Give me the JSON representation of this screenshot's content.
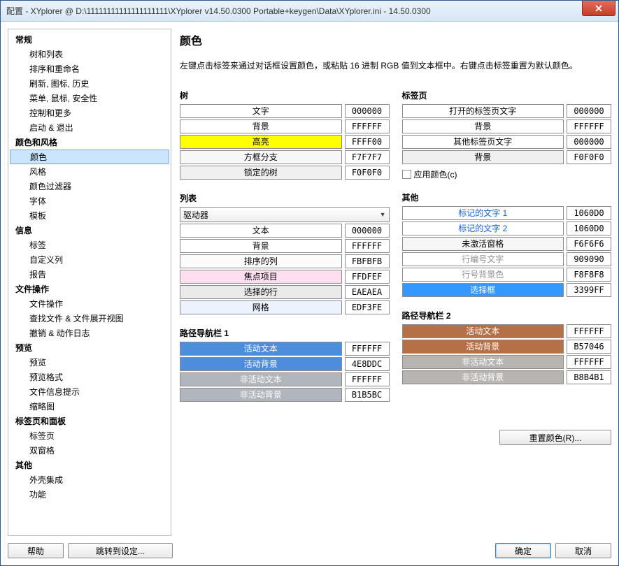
{
  "window": {
    "title": "配置 - XYplorer @ D:\\11111111111111111111\\XYplorer v14.50.0300 Portable+keygen\\Data\\XYplorer.ini - 14.50.0300"
  },
  "sidebar": {
    "groups": [
      {
        "label": "常规",
        "children": [
          "树和列表",
          "排序和重命名",
          "刷新, 图标, 历史",
          "菜单, 鼠标, 安全性",
          "控制和更多",
          "启动 & 退出"
        ]
      },
      {
        "label": "颜色和风格",
        "children": [
          "颜色",
          "风格",
          "颜色过滤器",
          "字体",
          "模板"
        ],
        "selectedIndex": 0
      },
      {
        "label": "信息",
        "children": [
          "标签",
          "自定义列",
          "报告"
        ]
      },
      {
        "label": "文件操作",
        "children": [
          "文件操作",
          "查找文件 & 文件展开视图",
          "撤销 & 动作日志"
        ]
      },
      {
        "label": "预览",
        "children": [
          "预览",
          "预览格式",
          "文件信息提示",
          "缩略图"
        ]
      },
      {
        "label": "标签页和面板",
        "children": [
          "标签页",
          "双窗格"
        ]
      },
      {
        "label": "其他",
        "children": [
          "外壳集成",
          "功能"
        ]
      }
    ]
  },
  "content": {
    "title": "颜色",
    "description": "左键点击标签来通过对话框设置颜色，或粘贴 16 进制 RGB 值到文本框中。右键点击标签重置为默认颜色。",
    "sections": {
      "tree": {
        "label": "树",
        "rows": [
          {
            "name": "文字",
            "hex": "000000",
            "bg": "#FFFFFF",
            "fg": "#000000"
          },
          {
            "name": "背景",
            "hex": "FFFFFF",
            "bg": "#FFFFFF",
            "fg": "#000000"
          },
          {
            "name": "高亮",
            "hex": "FFFF00",
            "bg": "#FFFF00",
            "fg": "#000000"
          },
          {
            "name": "方框分支",
            "hex": "F7F7F7",
            "bg": "#F7F7F7",
            "fg": "#000000"
          },
          {
            "name": "锁定的树",
            "hex": "F0F0F0",
            "bg": "#F0F0F0",
            "fg": "#000000"
          }
        ]
      },
      "list": {
        "label": "列表",
        "dropdown": "驱动器",
        "rows": [
          {
            "name": "文本",
            "hex": "000000",
            "bg": "#FFFFFF",
            "fg": "#000000"
          },
          {
            "name": "背景",
            "hex": "FFFFFF",
            "bg": "#FFFFFF",
            "fg": "#000000"
          },
          {
            "name": "排序的列",
            "hex": "FBFBFB",
            "bg": "#FBFBFB",
            "fg": "#000000"
          },
          {
            "name": "焦点项目",
            "hex": "FFDFEF",
            "bg": "#FFDFEF",
            "fg": "#000000"
          },
          {
            "name": "选择的行",
            "hex": "EAEAEA",
            "bg": "#EAEAEA",
            "fg": "#000000"
          },
          {
            "name": "网格",
            "hex": "EDF3FE",
            "bg": "#EDF3FE",
            "fg": "#000000"
          }
        ]
      },
      "crumb1": {
        "label": "路径导航栏 1",
        "rows": [
          {
            "name": "活动文本",
            "hex": "FFFFFF",
            "bg": "#4E8DDC",
            "fg": "#FFFFFF"
          },
          {
            "name": "活动背景",
            "hex": "4E8DDC",
            "bg": "#4E8DDC",
            "fg": "#FFFFFF"
          },
          {
            "name": "非活动文本",
            "hex": "FFFFFF",
            "bg": "#B1B5BC",
            "fg": "#FFFFFF"
          },
          {
            "name": "非活动背景",
            "hex": "B1B5BC",
            "bg": "#B1B5BC",
            "fg": "#FFFFFF"
          }
        ]
      },
      "tabs": {
        "label": "标签页",
        "rows": [
          {
            "name": "打开的标签页文字",
            "hex": "000000",
            "bg": "#FFFFFF",
            "fg": "#000000"
          },
          {
            "name": "背景",
            "hex": "FFFFFF",
            "bg": "#FFFFFF",
            "fg": "#000000"
          },
          {
            "name": "其他标签页文字",
            "hex": "000000",
            "bg": "#FFFFFF",
            "fg": "#000000"
          },
          {
            "name": "背景",
            "hex": "F0F0F0",
            "bg": "#F0F0F0",
            "fg": "#000000"
          }
        ],
        "checkbox": "应用颜色(c)"
      },
      "other": {
        "label": "其他",
        "rows": [
          {
            "name": "标记的文字 1",
            "hex": "1060D0",
            "bg": "#FFFFFF",
            "fg": "#1060D0"
          },
          {
            "name": "标记的文字 2",
            "hex": "1060D0",
            "bg": "#FFFFFF",
            "fg": "#1060D0"
          },
          {
            "name": "未激活窗格",
            "hex": "F6F6F6",
            "bg": "#F6F6F6",
            "fg": "#000000"
          },
          {
            "name": "行编号文字",
            "hex": "909090",
            "bg": "#FFFFFF",
            "fg": "#909090"
          },
          {
            "name": "行号背景色",
            "hex": "F8F8F8",
            "bg": "#FFFFFF",
            "fg": "#909090"
          },
          {
            "name": "选择框",
            "hex": "3399FF",
            "bg": "#3399FF",
            "fg": "#FFFFFF"
          }
        ]
      },
      "crumb2": {
        "label": "路径导航栏 2",
        "rows": [
          {
            "name": "活动文本",
            "hex": "FFFFFF",
            "bg": "#B57046",
            "fg": "#FFFFFF"
          },
          {
            "name": "活动背景",
            "hex": "B57046",
            "bg": "#B57046",
            "fg": "#FFFFFF"
          },
          {
            "name": "非活动文本",
            "hex": "FFFFFF",
            "bg": "#B8B4B1",
            "fg": "#FFFFFF"
          },
          {
            "name": "非活动背景",
            "hex": "B8B4B1",
            "bg": "#B8B4B1",
            "fg": "#FFFFFF"
          }
        ]
      }
    },
    "reset": "重置颜色(R)..."
  },
  "footer": {
    "help": "帮助",
    "jump": "跳转到设定...",
    "ok": "确定",
    "cancel": "取消"
  }
}
